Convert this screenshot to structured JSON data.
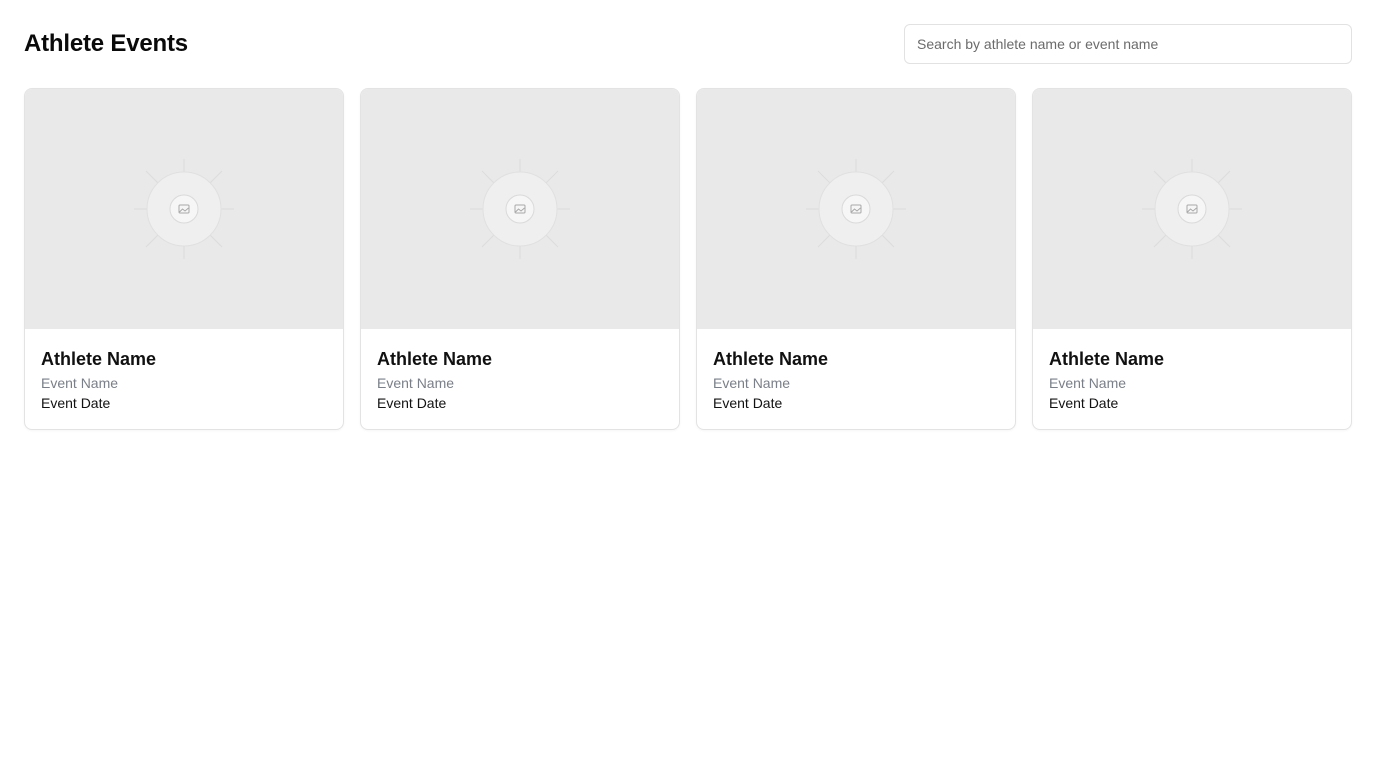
{
  "header": {
    "title": "Athlete Events",
    "search": {
      "placeholder": "Search by athlete name or event name",
      "value": ""
    }
  },
  "cards": [
    {
      "athlete_name": "Athlete Name",
      "event_name": "Event Name",
      "event_date": "Event Date",
      "image_icon": "image-placeholder-icon"
    },
    {
      "athlete_name": "Athlete Name",
      "event_name": "Event Name",
      "event_date": "Event Date",
      "image_icon": "image-placeholder-icon"
    },
    {
      "athlete_name": "Athlete Name",
      "event_name": "Event Name",
      "event_date": "Event Date",
      "image_icon": "image-placeholder-icon"
    },
    {
      "athlete_name": "Athlete Name",
      "event_name": "Event Name",
      "event_date": "Event Date",
      "image_icon": "image-placeholder-icon"
    }
  ],
  "colors": {
    "image_bg": "#e9e9e9",
    "card_border": "#e3e3e3",
    "muted_text": "#7a7f88"
  }
}
